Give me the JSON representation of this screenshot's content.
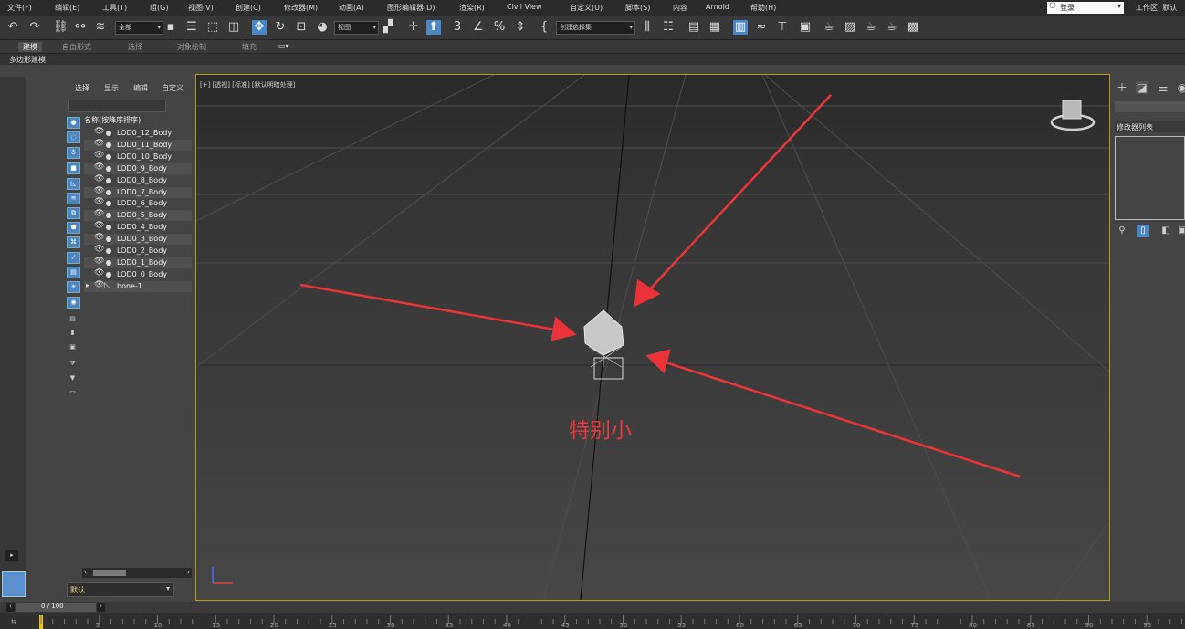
{
  "menu": [
    "文件(F)",
    "编辑(E)",
    "工具(T)",
    "组(G)",
    "视图(V)",
    "创建(C)",
    "修改器(M)",
    "动画(A)",
    "图形编辑器(D)",
    "渲染(R)",
    "Civil View",
    "自定义(U)",
    "脚本(S)",
    "内容",
    "Arnold",
    "帮助(H)"
  ],
  "account": {
    "login_label": "登录",
    "workspace_label": "工作区: 默认"
  },
  "toolbar": {
    "select_filter": "全部",
    "ref_coord": "视图",
    "named_selection": "创建选择集"
  },
  "ribbon": {
    "tabs": [
      "建模",
      "自由形式",
      "选择",
      "对象绘制",
      "填充"
    ],
    "active_tab": "建模",
    "sub_label": "多边形建模"
  },
  "explorer": {
    "menu": [
      "选择",
      "显示",
      "编辑",
      "自定义"
    ],
    "column_header": "名称(按降序排序)",
    "objects": [
      "LOD0_12_Body",
      "LOD0_11_Body",
      "LOD0_10_Body",
      "LOD0_9_Body",
      "LOD0_8_Body",
      "LOD0_7_Body",
      "LOD0_6_Body",
      "LOD0_5_Body",
      "LOD0_4_Body",
      "LOD0_3_Body",
      "LOD0_2_Body",
      "LOD0_1_Body",
      "LOD0_0_Body"
    ],
    "bone": "bone-1",
    "layer": "默认"
  },
  "viewport": {
    "label": "[+] [透视] [标准] [默认明暗处理]",
    "annotation": "特别小",
    "border_color": "#b2991e",
    "annotation_color": "#e7383d"
  },
  "right_panel": {
    "modifier_list": "修改器列表"
  },
  "timeline": {
    "frame_display": "0 / 100",
    "ticks": [
      "5",
      "10",
      "15",
      "20",
      "25",
      "30",
      "35",
      "40",
      "45",
      "50",
      "55",
      "60",
      "65",
      "70",
      "75",
      "80",
      "85",
      "90",
      "95"
    ]
  }
}
